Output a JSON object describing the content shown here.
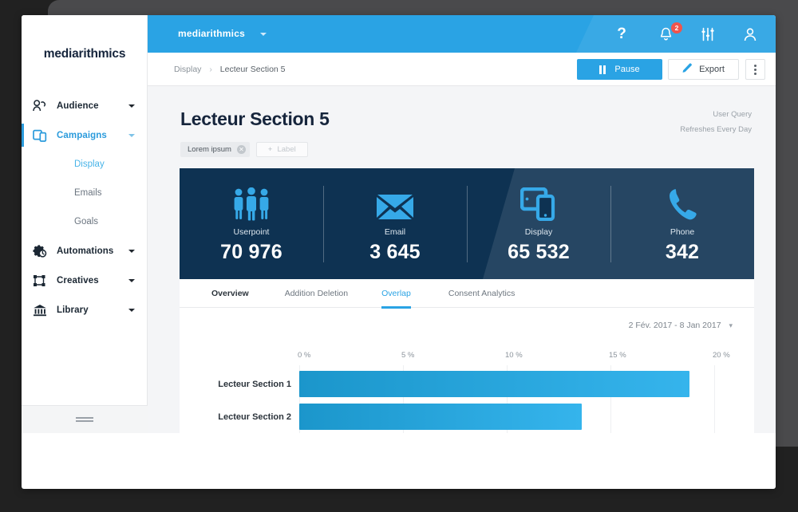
{
  "sidebar": {
    "logo": "mediarithmics",
    "items": [
      {
        "label": "Audience",
        "icon": "audience-icon",
        "active": false,
        "caret": true
      },
      {
        "label": "Campaigns",
        "icon": "campaigns-icon",
        "active": true,
        "caret": true
      },
      {
        "label": "Automations",
        "icon": "automations-icon",
        "active": false,
        "caret": true
      },
      {
        "label": "Creatives",
        "icon": "creatives-icon",
        "active": false,
        "caret": true
      },
      {
        "label": "Library",
        "icon": "library-icon",
        "active": false,
        "caret": true
      }
    ],
    "sub_items": [
      {
        "label": "Display",
        "active": true
      },
      {
        "label": "Emails",
        "active": false
      },
      {
        "label": "Goals",
        "active": false
      }
    ],
    "collapse_icon": "hamburger-collapse-icon"
  },
  "topbar": {
    "brand": "mediarithmics",
    "brand_caret_icon": "chevron-down-icon",
    "help_icon": "question-mark-icon",
    "bell_icon": "bell-icon",
    "notification_count": "2",
    "settings_icon": "sliders-icon",
    "user_icon": "user-avatar-icon",
    "accent_color": "#2aa3e4"
  },
  "breadcrumb": {
    "root": "Display",
    "separator": "›",
    "current": "Lecteur Section 5"
  },
  "actions": {
    "pause_label": "Pause",
    "pause_icon": "pause-icon",
    "export_label": "Export",
    "export_icon": "pencil-icon",
    "more_icon": "kebab-menu-icon"
  },
  "page": {
    "title": "Lecteur Section 5",
    "tag_label": "Lorem ipsum",
    "tag_remove_icon": "close-circle-icon",
    "add_label_text": "Label",
    "add_label_icon": "plus-icon",
    "meta_line1": "User Query",
    "meta_line2": "Refreshes Every Day"
  },
  "kpis": [
    {
      "label": "Userpoint",
      "value": "70 976",
      "icon": "people-group-icon"
    },
    {
      "label": "Email",
      "value": "3 645",
      "icon": "envelope-icon"
    },
    {
      "label": "Display",
      "value": "65 532",
      "icon": "tablet-phone-icon"
    },
    {
      "label": "Phone",
      "value": "342",
      "icon": "phone-handset-icon"
    }
  ],
  "tabs": [
    {
      "label": "Overview",
      "active": false,
      "bold": true
    },
    {
      "label": "Addition Deletion",
      "active": false,
      "bold": false
    },
    {
      "label": "Overlap",
      "active": true,
      "bold": false
    },
    {
      "label": "Consent Analytics",
      "active": false,
      "bold": false
    }
  ],
  "date_range": {
    "text": "2 Fév. 2017  -  8 Jan 2017",
    "chevron_icon": "chevron-down-icon"
  },
  "chart_data": {
    "type": "bar",
    "orientation": "horizontal",
    "title": "",
    "xlabel": "",
    "ylabel": "",
    "categories": [
      "Lecteur Section 1",
      "Lecteur Section 2"
    ],
    "values": [
      18.8,
      13.6
    ],
    "tick_labels": [
      "0 %",
      "5 %",
      "10 %",
      "15 %",
      "20 %"
    ],
    "tick_values": [
      0,
      5,
      10,
      15,
      20
    ],
    "xlim": [
      0,
      20
    ],
    "grid": true,
    "legend": "none",
    "bar_color_start": "#1b96cb",
    "bar_color_end": "#35b4ec"
  }
}
